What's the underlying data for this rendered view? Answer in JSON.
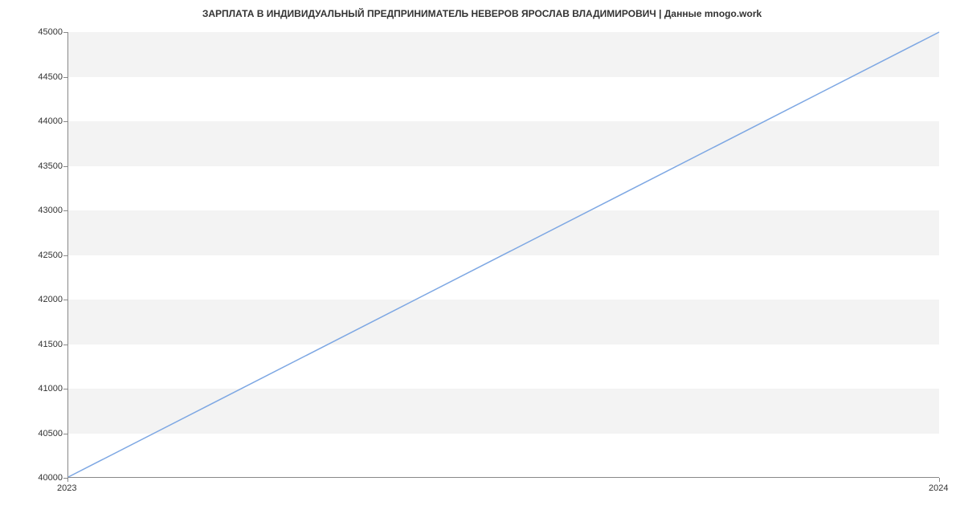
{
  "chart_data": {
    "type": "line",
    "title": "ЗАРПЛАТА В ИНДИВИДУАЛЬНЫЙ ПРЕДПРИНИМАТЕЛЬ НЕВЕРОВ ЯРОСЛАВ ВЛАДИМИРОВИЧ | Данные mnogo.work",
    "xlabel": "",
    "ylabel": "",
    "x_ticks": [
      "2023",
      "2024"
    ],
    "y_ticks": [
      40000,
      40500,
      41000,
      41500,
      42000,
      42500,
      43000,
      43500,
      44000,
      44500,
      45000
    ],
    "ylim": [
      40000,
      45000
    ],
    "x": [
      "2023",
      "2024"
    ],
    "values": [
      40000,
      45000
    ],
    "line_color": "#7da7e3"
  }
}
